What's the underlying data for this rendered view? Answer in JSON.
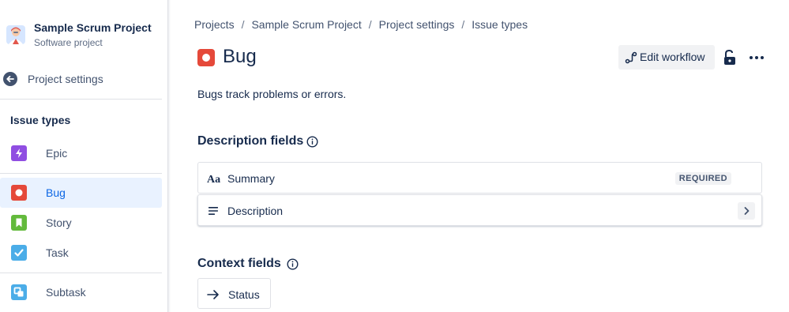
{
  "sidebar": {
    "project_name": "Sample Scrum Project",
    "project_type": "Software project",
    "back_label": "Project settings",
    "section_title": "Issue types",
    "items": [
      {
        "label": "Epic",
        "icon": "epic-icon",
        "color": "#904ee2"
      },
      {
        "label": "Bug",
        "icon": "bug-icon",
        "color": "#e5493a",
        "selected": true
      },
      {
        "label": "Story",
        "icon": "story-icon",
        "color": "#63ba3c"
      },
      {
        "label": "Task",
        "icon": "task-icon",
        "color": "#4bade8"
      },
      {
        "label": "Subtask",
        "icon": "subtask-icon",
        "color": "#4bade8"
      }
    ]
  },
  "breadcrumb": [
    "Projects",
    "Sample Scrum Project",
    "Project settings",
    "Issue types"
  ],
  "page": {
    "title": "Bug",
    "title_icon": "bug-icon",
    "edit_workflow_label": "Edit workflow",
    "description": "Bugs track problems or errors."
  },
  "description_fields": {
    "heading": "Description fields",
    "fields": [
      {
        "label": "Summary",
        "icon": "text-aa-icon",
        "badge": "REQUIRED"
      },
      {
        "label": "Description",
        "icon": "paragraph-lines-icon"
      }
    ]
  },
  "context_fields": {
    "heading": "Context fields",
    "fields": [
      {
        "label": "Status",
        "icon": "arrow-right-icon"
      }
    ]
  },
  "colors": {
    "text": "#172b4d",
    "subtle_text": "#42526e",
    "selected_bg": "#e9f2ff",
    "selected_text": "#0c66e4",
    "bug_red": "#e5493a"
  }
}
